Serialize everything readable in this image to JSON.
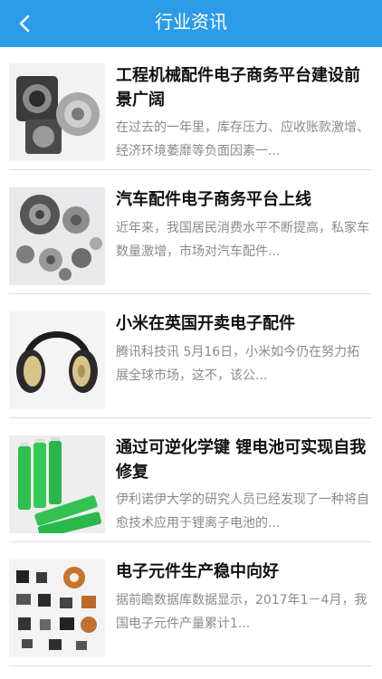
{
  "header": {
    "title": "行业资讯"
  },
  "articles": [
    {
      "title": "工程机械配件电子商务平台建设前景广阔",
      "summary": "在过去的一年里，库存压力、应收账款激增、经济环境萎靡等负面因素一...",
      "image": "machinery-parts"
    },
    {
      "title": "汽车配件电子商务平台上线",
      "summary": "近年来，我国居民消费水平不断提高，私家车数量激增，市场对汽车配件...",
      "image": "auto-gears"
    },
    {
      "title": "小米在英国开卖电子配件",
      "summary": "腾讯科技讯 5月16日，小米如今仍在努力拓展全球市场，这不，该公...",
      "image": "headphones"
    },
    {
      "title": "通过可逆化学键 锂电池可实现自我修复",
      "summary": "伊利诺伊大学的研究人员已经发现了一种将自愈技术应用于锂离子电池的...",
      "image": "lithium-batteries"
    },
    {
      "title": "电子元件生产稳中向好",
      "summary": "据前瞻数据库数据显示，2017年1－4月，我国电子元件产量累计1...",
      "image": "electronic-components"
    }
  ]
}
